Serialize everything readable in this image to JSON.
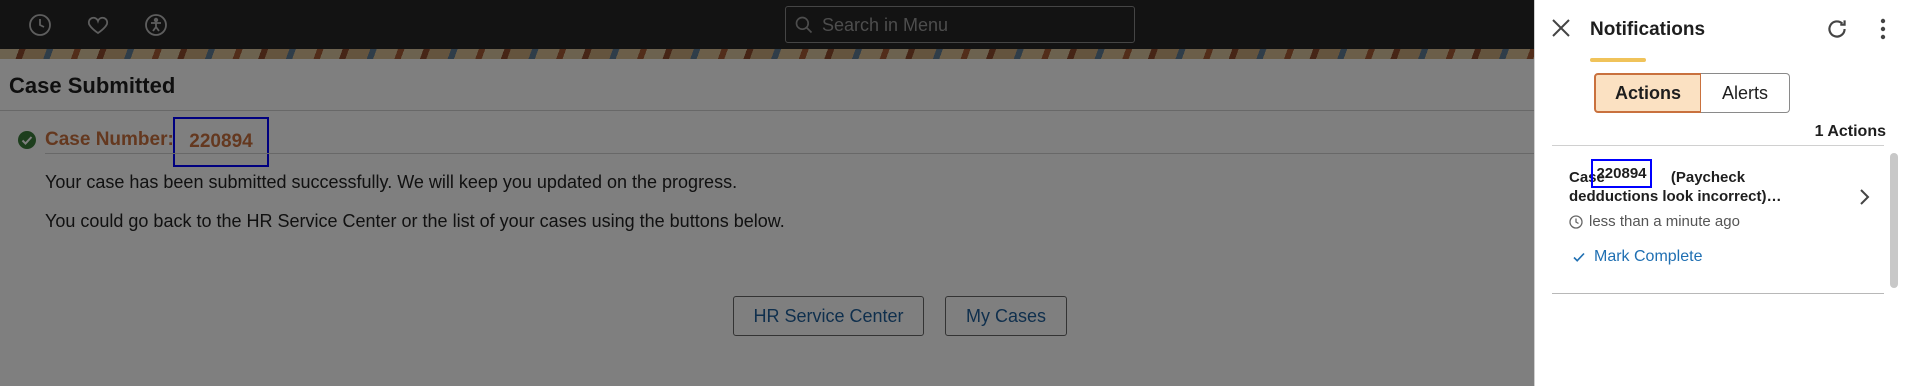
{
  "topbar": {
    "icons": [
      "recent-history-icon",
      "favorites-heart-icon",
      "accessibility-icon"
    ],
    "search": {
      "placeholder": "Search in Menu",
      "icon": "search-icon"
    }
  },
  "main": {
    "page_title": "Case Submitted",
    "case_label": "Case Number:",
    "case_number": "220894",
    "message_1": "Your case has been submitted successfully. We will keep you updated on the progress.",
    "message_2": "You could go back to the HR Service Center or the list of your cases using the buttons below.",
    "buttons": {
      "hr_service_center": "HR Service Center",
      "my_cases": "My Cases"
    }
  },
  "notifications": {
    "title": "Notifications",
    "tabs": {
      "actions": "Actions",
      "alerts": "Alerts",
      "selected": "Actions"
    },
    "actions_count": "1 Actions",
    "items": [
      {
        "title_prefix": "Case",
        "case_number": "220894",
        "title_rest": "(Paycheck dedductions look incorrect)…",
        "time": "less than a minute ago",
        "action": "Mark Complete"
      }
    ]
  },
  "colors": {
    "topbar": "#262626",
    "accent_orange": "#c9713e",
    "selected_tab_bg": "#fbe1c2",
    "link_blue": "#1f6fb2",
    "highlight_box": "#0000ff",
    "title_underline": "#f0c35a"
  }
}
